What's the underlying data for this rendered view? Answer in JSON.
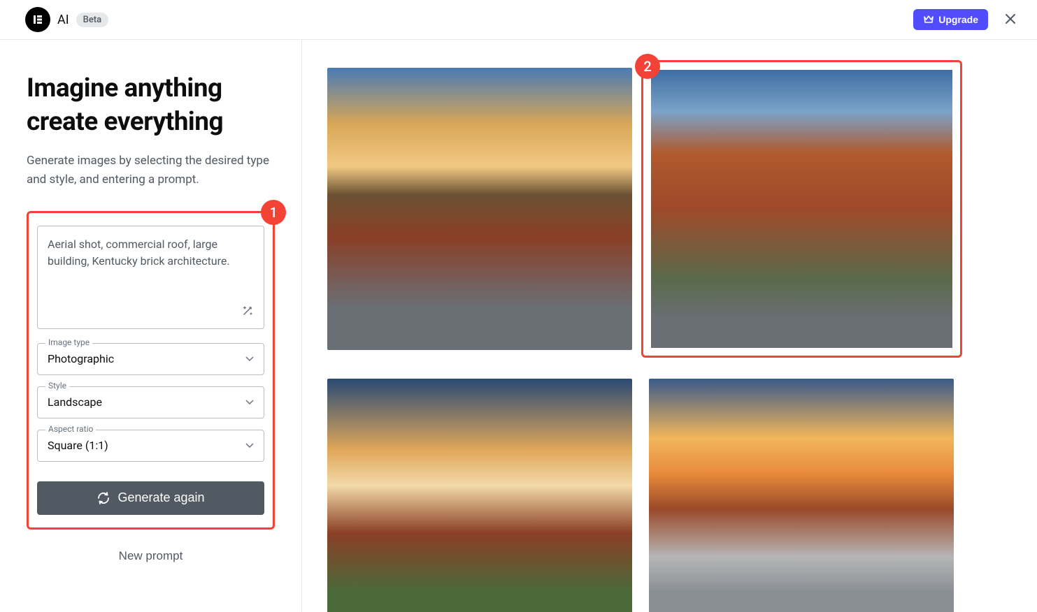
{
  "header": {
    "logo_text": "AI",
    "beta_label": "Beta",
    "upgrade_label": "Upgrade"
  },
  "sidebar": {
    "title_line1": "Imagine anything",
    "title_line2": "create everything",
    "subtitle": "Generate images by selecting the desired type and style, and entering a prompt.",
    "prompt_value": "Aerial shot, commercial roof, large building, Kentucky brick architecture.",
    "fields": {
      "image_type": {
        "label": "Image type",
        "value": "Photographic"
      },
      "style": {
        "label": "Style",
        "value": "Landscape"
      },
      "aspect_ratio": {
        "label": "Aspect ratio",
        "value": "Square (1:1)"
      }
    },
    "generate_label": "Generate again",
    "new_prompt_label": "New prompt"
  },
  "annotations": {
    "badge1": "1",
    "badge2": "2"
  }
}
